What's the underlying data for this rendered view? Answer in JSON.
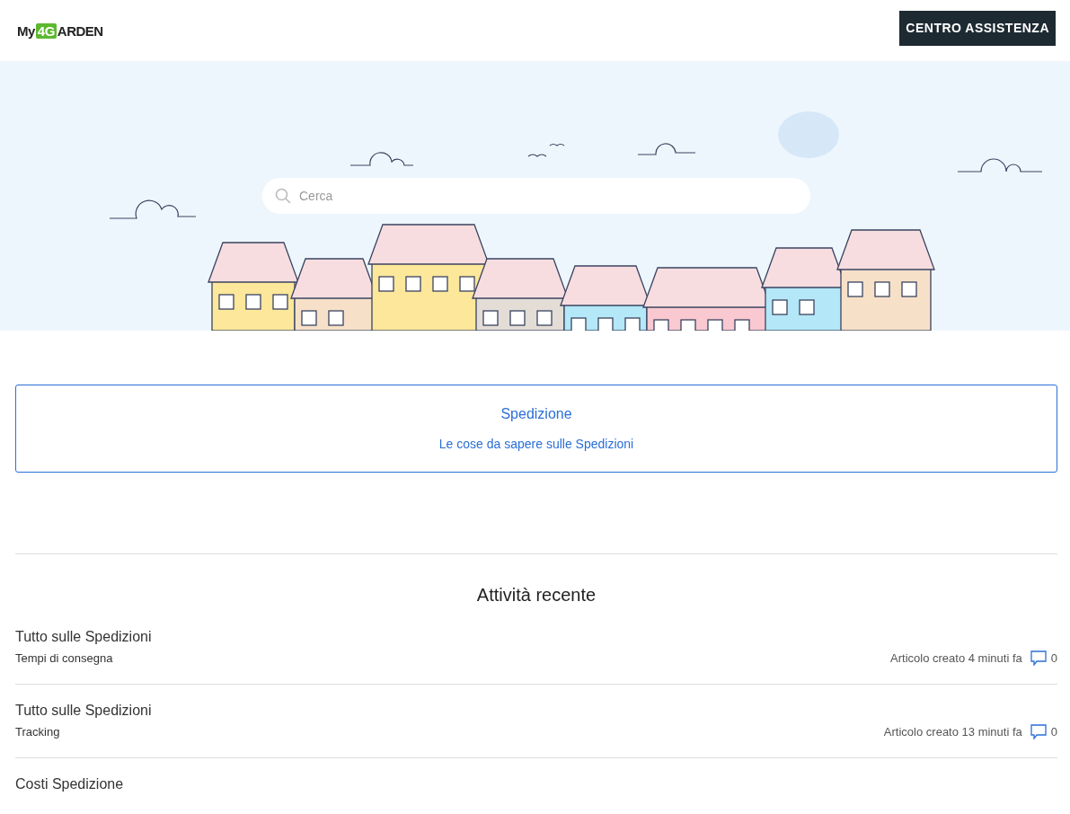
{
  "header": {
    "logo": {
      "prefix": "My",
      "badge": "4G",
      "suffix": "ARDEN"
    },
    "help_button": "CENTRO ASSISTENZA"
  },
  "hero": {
    "search": {
      "placeholder": "Cerca"
    }
  },
  "category_card": {
    "title": "Spedizione",
    "description": "Le cose da sapere sulle Spedizioni"
  },
  "recent_activity": {
    "heading": "Attività recente",
    "items": [
      {
        "section": "Tutto sulle Spedizioni",
        "article": "Tempi di consegna",
        "meta": "Articolo creato 4 minuti fa",
        "comments": "0"
      },
      {
        "section": "Tutto sulle Spedizioni",
        "article": "Tracking",
        "meta": "Articolo creato 13 minuti fa",
        "comments": "0"
      },
      {
        "section": "Costi Spedizione"
      }
    ]
  }
}
